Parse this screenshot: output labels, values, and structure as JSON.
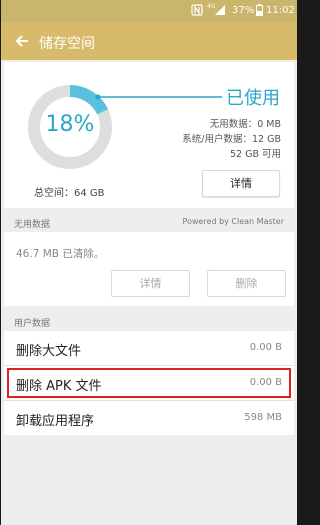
{
  "status_bar": {
    "battery": "37%",
    "time": "11:02",
    "network_badge": "4G",
    "icons": [
      "nfc-icon",
      "signal-icon",
      "battery-icon"
    ]
  },
  "app_bar": {
    "title": "储存空间",
    "back_icon": "arrow-left-icon"
  },
  "storage": {
    "percent": "18%",
    "percent_value": 0.18,
    "used_label": "已使用",
    "total": "总空间：64 GB",
    "stats": [
      "无用数据：0 MB",
      "系统/用户数据：12 GB",
      "52 GB 可用"
    ],
    "details_button": "详情",
    "colors": {
      "used": "#5bc0de",
      "free": "#dedede",
      "accent": "#2aa8c9"
    }
  },
  "junk_section": {
    "header": "无用数据",
    "powered_by": "Powered by Clean Master",
    "message": "46.7 MB 已清除。",
    "details_button": "详情",
    "delete_button": "删除"
  },
  "user_data_section": {
    "header": "用户数据",
    "rows": [
      {
        "label": "删除大文件",
        "value": "0.00 B"
      },
      {
        "label": "删除 APK 文件",
        "value": "0.00 B"
      },
      {
        "label": "卸载应用程序",
        "value": "598 MB"
      }
    ]
  },
  "highlight_color": "#e02020"
}
